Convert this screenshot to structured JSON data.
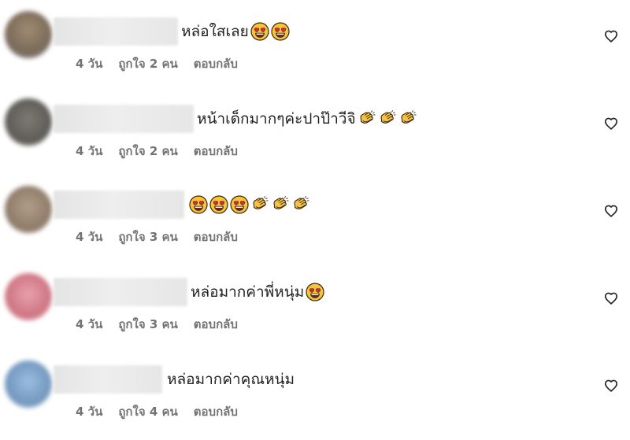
{
  "comments": [
    {
      "text": "หล่อใสเลย",
      "emojis": [
        "heart-eyes-emoji",
        "heart-eyes-emoji"
      ],
      "time": "4 วัน",
      "likes": "ถูกใจ 2 คน",
      "reply": "ตอบกลับ",
      "avatar_color": "#8a7763"
    },
    {
      "text": "หน้าเด็กมากๆค่ะปาป๊าวีจิ",
      "emojis": [
        "clapping-hands-emoji",
        "clapping-hands-emoji",
        "clapping-hands-emoji"
      ],
      "time": "4 วัน",
      "likes": "ถูกใจ 2 คน",
      "reply": "ตอบกลับ",
      "avatar_color": "#6b6b66"
    },
    {
      "text": "",
      "emojis": [
        "heart-eyes-emoji",
        "heart-eyes-emoji",
        "heart-eyes-emoji",
        "clapping-hands-emoji",
        "clapping-hands-emoji",
        "clapping-hands-emoji"
      ],
      "time": "4 วัน",
      "likes": "ถูกใจ 3 คน",
      "reply": "ตอบกลับ",
      "avatar_color": "#9c8a7a"
    },
    {
      "text": "หล่อมากค่าพี่หนุ่ม",
      "emojis": [
        "heart-eyes-emoji"
      ],
      "time": "4 วัน",
      "likes": "ถูกใจ 3 คน",
      "reply": "ตอบกลับ",
      "avatar_color": "#d98a97"
    },
    {
      "text": "หล่อมากค่าคุณหนุ่ม",
      "emojis": [],
      "time": "4 วัน",
      "likes": "ถูกใจ 4 คน",
      "reply": "ตอบกลับ",
      "avatar_color": "#86a9cc"
    }
  ],
  "colors": {
    "meta_text": "#737373",
    "comment_text": "#1f1f1f",
    "heart_outline": "#262626"
  },
  "icons": {
    "like": "heart-outline-icon"
  }
}
